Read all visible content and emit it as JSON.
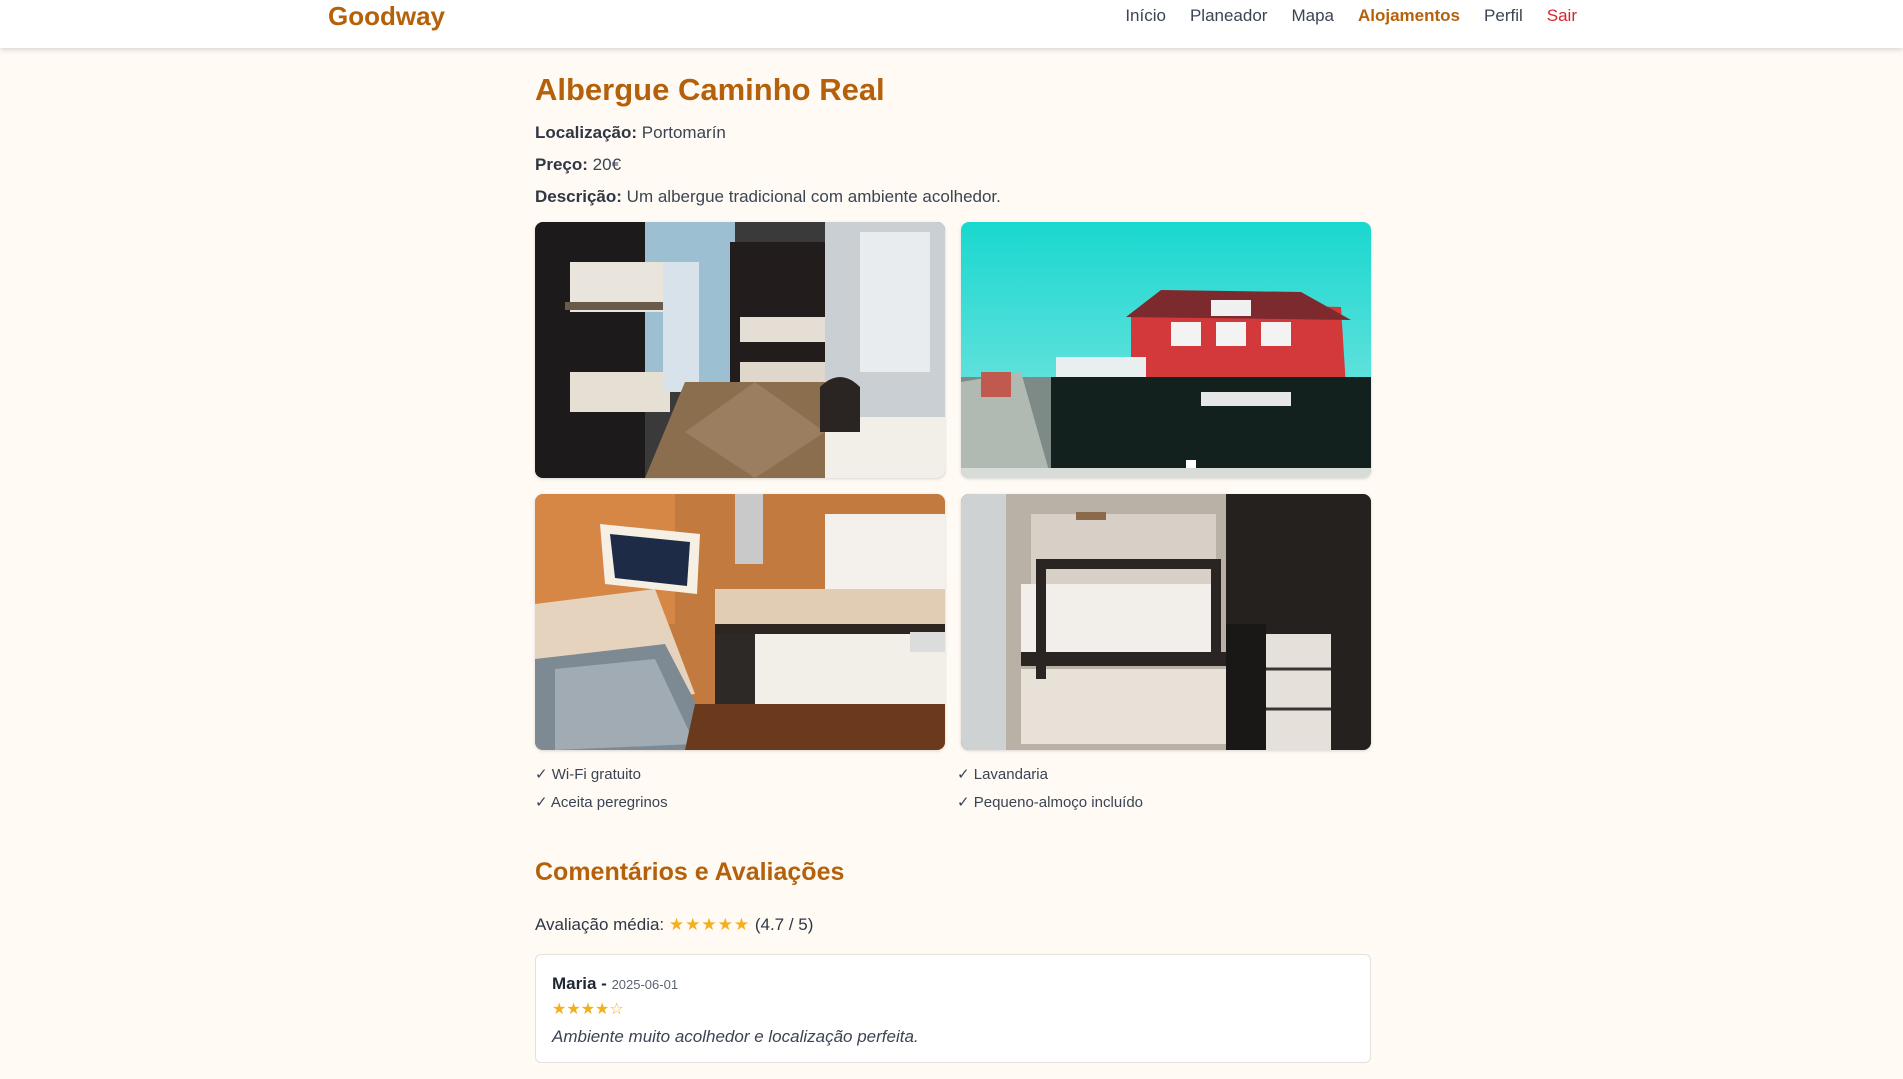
{
  "header": {
    "brand": "Goodway",
    "nav": [
      {
        "label": "Início",
        "state": "default"
      },
      {
        "label": "Planeador",
        "state": "default"
      },
      {
        "label": "Mapa",
        "state": "default"
      },
      {
        "label": "Alojamentos",
        "state": "active"
      },
      {
        "label": "Perfil",
        "state": "default"
      },
      {
        "label": "Sair",
        "state": "logout"
      }
    ],
    "colors": {
      "brand": "#b5610b",
      "logout": "#d0262c"
    }
  },
  "accommodation": {
    "title": "Albergue Caminho Real",
    "location_label": "Localização:",
    "location": "Portomarín",
    "price_label": "Preço:",
    "price": "20€",
    "description_label": "Descrição:",
    "description": "Um albergue tradicional com ambiente acolhedor.",
    "photos": [
      {
        "name": "photo-dormitory",
        "subject": "bunk-bed dormitory room"
      },
      {
        "name": "photo-building",
        "subject": "red building exterior"
      },
      {
        "name": "photo-kitchen",
        "subject": "shared kitchen"
      },
      {
        "name": "photo-bunk",
        "subject": "bunk bed close-up"
      }
    ],
    "amenities": [
      "✓ Wi-Fi gratuito",
      "✓ Lavandaria",
      "✓ Aceita peregrinos",
      "✓ Pequeno-almoço incluído"
    ]
  },
  "reviews": {
    "title": "Comentários e Avaliações",
    "average_label": "Avaliação média:",
    "average_stars": "★★★★★",
    "average_value": "(4.7 / 5)",
    "star_color": "#f2b01e",
    "items": [
      {
        "author": "Maria",
        "separator": "-",
        "date": "2025-06-01",
        "stars": "★★★★☆",
        "text": "Ambiente muito acolhedor e localização perfeita."
      }
    ]
  }
}
